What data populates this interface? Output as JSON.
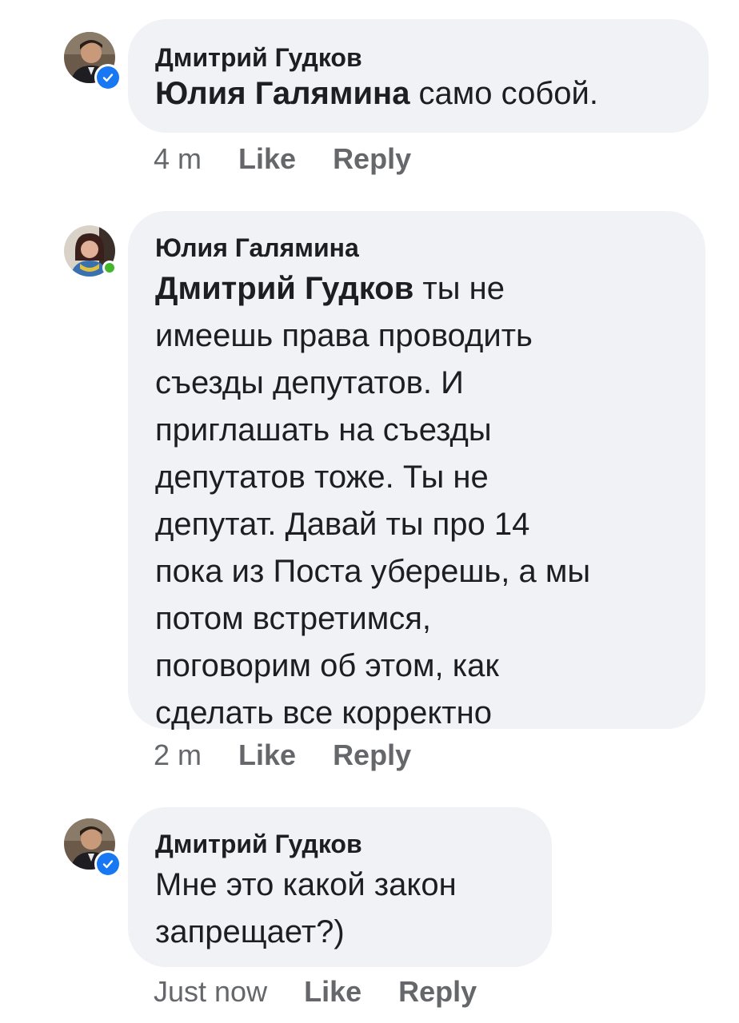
{
  "comments": [
    {
      "author": "Дмитрий Гудков",
      "mention": "Юлия Галямина",
      "text": " само собой.",
      "time": "4 m",
      "like_label": "Like",
      "reply_label": "Reply",
      "status": "verified"
    },
    {
      "author": "Юлия Галямина",
      "mention": "Дмитрий Гудков",
      "lines": [
        " ты не",
        "имеешь права проводить",
        "съезды депутатов. И",
        "приглашать на съезды",
        "депутатов тоже. Ты не",
        "депутат. Давай ты про 14",
        "пока из Поста уберешь, а мы",
        "потом встретимся,",
        "поговорим об этом, как",
        "сделать все корректно"
      ],
      "time": "2 m",
      "like_label": "Like",
      "reply_label": "Reply",
      "status": "online"
    },
    {
      "author": "Дмитрий Гудков",
      "lines": [
        "Мне это какой закон",
        "запрещает?)"
      ],
      "time": "Just now",
      "like_label": "Like",
      "reply_label": "Reply",
      "status": "verified"
    }
  ],
  "colors": {
    "bubble": "#f0f2f5",
    "text": "#1c1e21",
    "meta": "#65676b",
    "verified": "#1877f2",
    "online": "#42b72a"
  }
}
